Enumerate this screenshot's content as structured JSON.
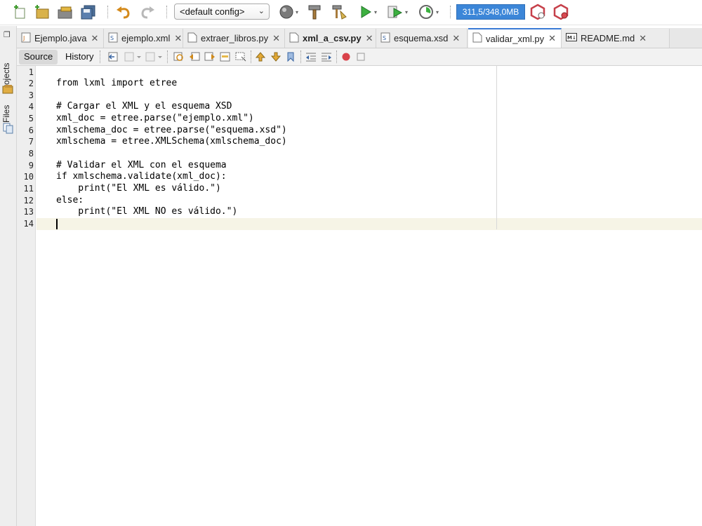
{
  "toolbar": {
    "config": "<default config>",
    "memory": "311,5/348,0MB",
    "icons": [
      "new-file-icon",
      "new-project-icon",
      "open-project-icon",
      "save-all-icon",
      "undo-icon",
      "redo-icon",
      "globe-icon",
      "build-icon",
      "clean-build-icon",
      "run-icon",
      "debug-icon",
      "profile-icon",
      "pause-gc-icon",
      "stop-gc-icon"
    ]
  },
  "side_bar": {
    "items": [
      "Projects",
      "Files"
    ]
  },
  "tabs": [
    {
      "label": "Ejemplo.java",
      "icon": "java-file-icon",
      "active": false,
      "bold": false
    },
    {
      "label": "ejemplo.xml",
      "icon": "xml-file-icon",
      "active": false,
      "bold": false
    },
    {
      "label": "extraer_libros.py",
      "icon": "python-file-icon",
      "active": false,
      "bold": false
    },
    {
      "label": "xml_a_csv.py",
      "icon": "python-file-icon",
      "active": false,
      "bold": true
    },
    {
      "label": "esquema.xsd",
      "icon": "xsd-file-icon",
      "active": false,
      "bold": false
    },
    {
      "label": "validar_xml.py",
      "icon": "python-file-icon",
      "active": true,
      "bold": false
    },
    {
      "label": "README.md",
      "icon": "markdown-file-icon",
      "active": false,
      "bold": false
    }
  ],
  "editor_toolbar": {
    "source_label": "Source",
    "history_label": "History"
  },
  "editor": {
    "lines": [
      "",
      "from lxml import etree",
      "",
      "# Cargar el XML y el esquema XSD",
      "xml_doc = etree.parse(\"ejemplo.xml\")",
      "xmlschema_doc = etree.parse(\"esquema.xsd\")",
      "xmlschema = etree.XMLSchema(xmlschema_doc)",
      "",
      "# Validar el XML con el esquema",
      "if xmlschema.validate(xml_doc):",
      "    print(\"El XML es válido.\")",
      "else:",
      "    print(\"El XML NO es válido.\")",
      ""
    ],
    "line_numbers": [
      "1",
      "2",
      "3",
      "4",
      "5",
      "6",
      "7",
      "8",
      "9",
      "10",
      "11",
      "12",
      "13",
      "14"
    ],
    "current_line": "14"
  },
  "colors": {
    "accent": "#3a7bd5",
    "memory_bar": "#3c86d8",
    "current_line_bg": "#f6f4e6"
  }
}
